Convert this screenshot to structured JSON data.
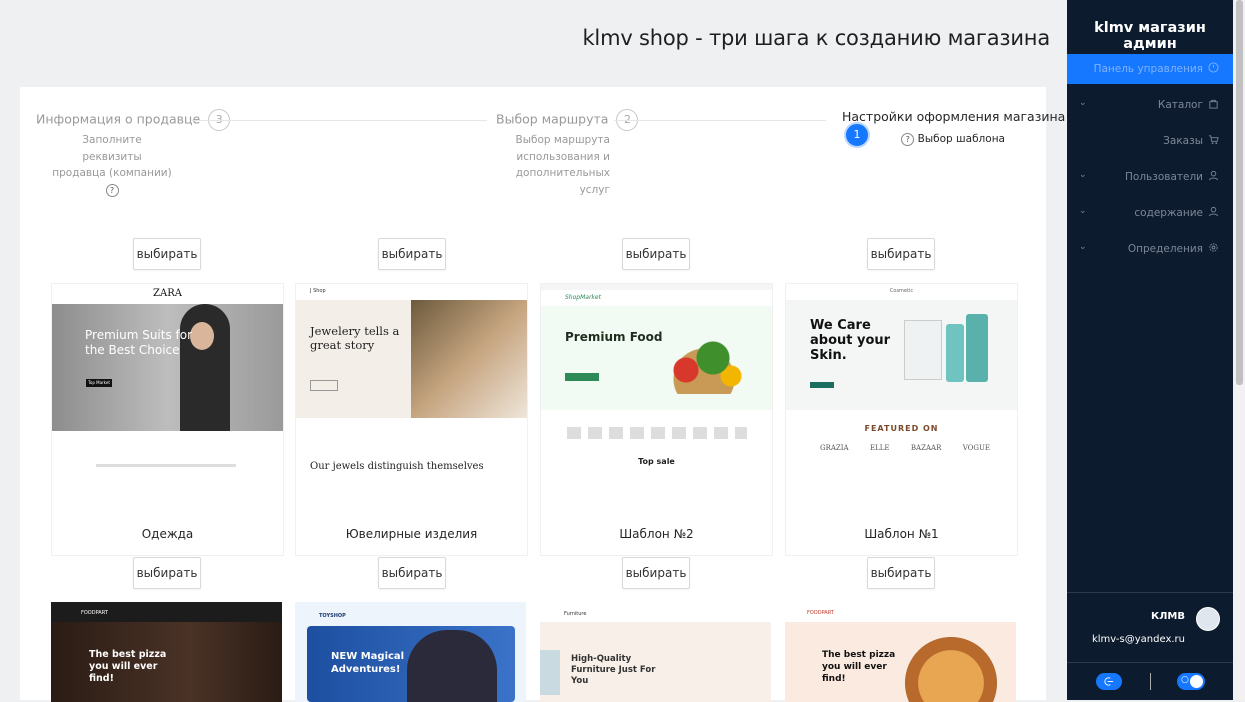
{
  "header": {
    "title": "klmv shop - три шага к созданию магазина"
  },
  "steps": [
    {
      "title": "Информация о продавце",
      "num": "3",
      "desc": [
        "Заполните реквизиты",
        "продавца (компании)"
      ]
    },
    {
      "title": "Выбор маршрута",
      "num": "2",
      "desc": [
        "Выбор маршрута",
        "использования и",
        "дополнительных",
        "услуг"
      ]
    },
    {
      "title": "Настройки оформления магазина",
      "num": "1",
      "desc": [
        "Выбор шаблона"
      ]
    }
  ],
  "select_label": "выбирать",
  "templates": [
    {
      "label": "Одежда",
      "brand": "ZARA",
      "headline": "Premium Suits for the Best Choice",
      "cta": "Top Market"
    },
    {
      "label": "Ювелирные изделия",
      "brand": "J Shop",
      "headline": "Jewelery tells a great story",
      "footer": "Our jewels distinguish themselves"
    },
    {
      "label": "Шаблон №2",
      "brand": "ShopMarket",
      "headline": "Premium Food",
      "section": "Top sale"
    },
    {
      "label": "Шаблон №1",
      "brand": "Cosmetic",
      "headline": "We Care about your Skin.",
      "section": "FEATURED ON",
      "logos": [
        "GRAZIA",
        "ELLE",
        "BAZAAR",
        "VOGUE"
      ]
    }
  ],
  "templates_row2": [
    {
      "brand": "FOODPART",
      "headline": "The best pizza you will ever find!"
    },
    {
      "brand": "TOYSHOP",
      "headline": "NEW Magical Adventures!"
    },
    {
      "brand": "Furniture",
      "headline": "High-Quality Furniture Just For You"
    },
    {
      "brand": "FOODPART",
      "headline": "The best pizza you will ever find!"
    }
  ],
  "sidebar": {
    "brand": "klmv магазин админ",
    "items": [
      {
        "label": "Панель управления",
        "icon": "dashboard-icon"
      },
      {
        "label": "Каталог",
        "icon": "bag-icon"
      },
      {
        "label": "Заказы",
        "icon": "cart-icon"
      },
      {
        "label": "Пользователи",
        "icon": "user-icon"
      },
      {
        "label": "содержание",
        "icon": "user-icon"
      },
      {
        "label": "Определения",
        "icon": "gear-icon"
      }
    ],
    "user": {
      "name": "КЛМВ",
      "email": "klmv-s@yandex.ru"
    }
  },
  "colors": {
    "accent": "#1677ff",
    "sidebar_bg": "#0d1b2e"
  }
}
